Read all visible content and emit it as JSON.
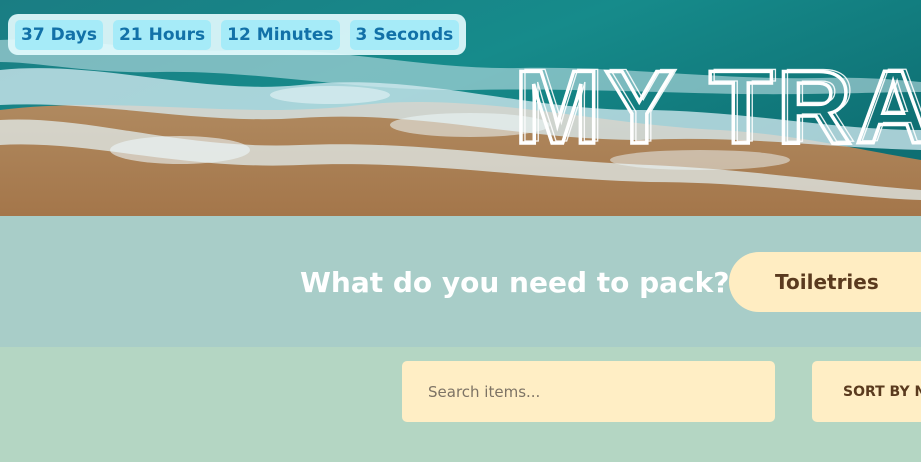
{
  "countdown": {
    "days": {
      "value": "37",
      "unit": "Days"
    },
    "hours": {
      "value": "21",
      "unit": "Hours"
    },
    "minutes": {
      "value": "12",
      "unit": "Minutes"
    },
    "seconds": {
      "value": "3",
      "unit": "Seconds"
    }
  },
  "hero": {
    "title": "MY TRA"
  },
  "packing": {
    "prompt": "What do you need to pack?",
    "category_selected": "Toiletries"
  },
  "controls": {
    "search_placeholder": "Search items...",
    "sort_label": "SORT BY NA"
  },
  "colors": {
    "chip_bg": "#a6ebf8",
    "chip_text": "#1271a8",
    "prompt_band": "#a8cdc8",
    "controls_band": "#b4d6c3",
    "cream": "#ffeec5",
    "brown_text": "#5a3a1e"
  }
}
